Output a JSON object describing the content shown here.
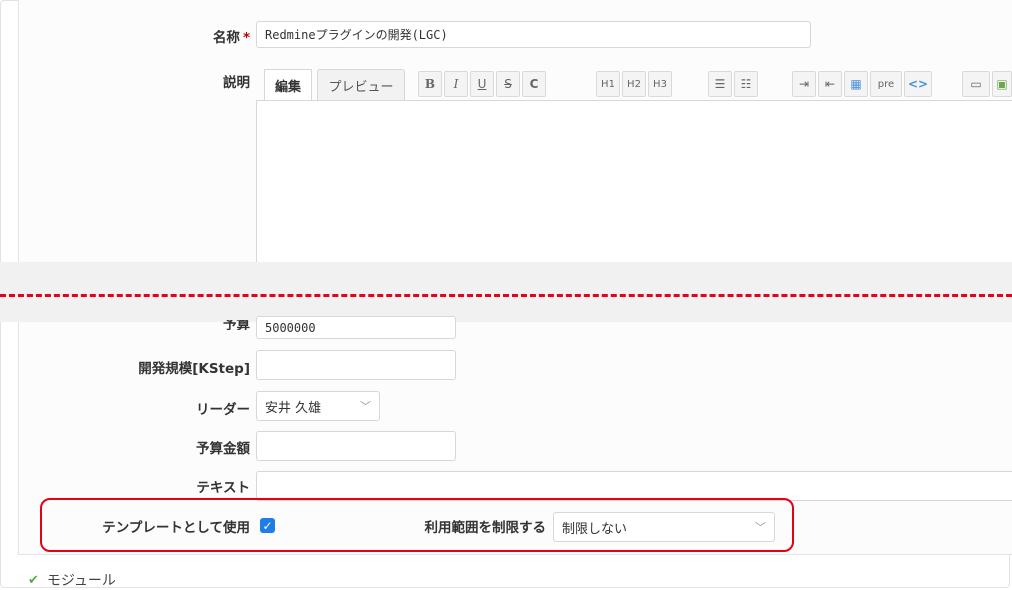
{
  "form": {
    "name": {
      "label": "名称",
      "required_mark": "*",
      "value": "Redmineプラグインの開発(LGC)"
    },
    "description": {
      "label": "説明",
      "tabs": [
        {
          "label": "編集"
        },
        {
          "label": "プレビュー"
        }
      ],
      "toolbar": [
        {
          "label": "B",
          "icon": "bold-icon"
        },
        {
          "label": "I",
          "icon": "italic-icon"
        },
        {
          "label": "U",
          "icon": "underline-icon"
        },
        {
          "label": "S",
          "icon": "strikethrough-icon"
        },
        {
          "label": "C",
          "icon": "code-inline-icon"
        },
        {
          "label": "H1",
          "icon": "heading1-icon"
        },
        {
          "label": "H2",
          "icon": "heading2-icon"
        },
        {
          "label": "H3",
          "icon": "heading3-icon"
        },
        {
          "label": "☰",
          "icon": "bullet-list-icon"
        },
        {
          "label": "☷",
          "icon": "numbered-list-icon"
        },
        {
          "label": "⇥",
          "icon": "indent-icon"
        },
        {
          "label": "⇤",
          "icon": "outdent-icon"
        },
        {
          "label": "▦",
          "icon": "table-icon"
        },
        {
          "label": "pre",
          "icon": "pre-icon"
        },
        {
          "label": "<>",
          "icon": "code-block-icon"
        },
        {
          "label": "▭",
          "icon": "link-icon"
        },
        {
          "label": "▣",
          "icon": "image-icon"
        }
      ],
      "value": ""
    },
    "budget": {
      "label": "予算",
      "value": "5000000"
    },
    "dev_scale": {
      "label": "開発規模[KStep]",
      "value": ""
    },
    "leader": {
      "label": "リーダー",
      "value": "安井 久雄"
    },
    "budget_amount": {
      "label": "予算金額",
      "value": ""
    },
    "text": {
      "label": "テキスト",
      "value": ""
    },
    "template": {
      "label": "テンプレートとして使用",
      "checked": true
    },
    "scope": {
      "label": "利用範囲を制限する",
      "value": "制限しない"
    }
  },
  "modules": {
    "label": "モジュール"
  },
  "colors": {
    "highlight": "#e60012",
    "cut_line": "#e8001c",
    "checkbox": "#1f7dea",
    "required": "#bb0000"
  }
}
